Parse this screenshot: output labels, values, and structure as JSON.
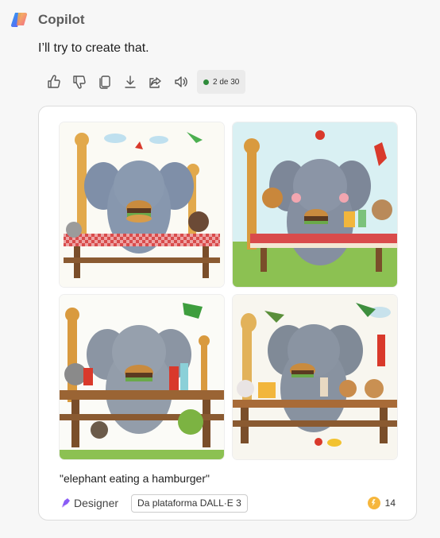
{
  "app": {
    "name": "Copilot"
  },
  "message": {
    "text": "I’ll try to create that."
  },
  "toolbar": {
    "actions": [
      {
        "icon": "thumbs-up-icon",
        "label": "Like"
      },
      {
        "icon": "thumbs-down-icon",
        "label": "Dislike"
      },
      {
        "icon": "copy-icon",
        "label": "Copy"
      },
      {
        "icon": "download-icon",
        "label": "Download"
      },
      {
        "icon": "share-icon",
        "label": "Share"
      },
      {
        "icon": "speaker-icon",
        "label": "Read aloud"
      }
    ],
    "counter": "2 de 30",
    "counter_color": "#2e8b3a"
  },
  "result": {
    "prompt": "\"elephant eating a hamburger\"",
    "images": [
      {
        "alt": "elephant eating a hamburger"
      },
      {
        "alt": "elephant eating a hamburger"
      },
      {
        "alt": "elephant eating a hamburger"
      },
      {
        "alt": "elephant eating a hamburger"
      }
    ],
    "source_label": "Designer",
    "platform_badge": "Da plataforma DALL·E 3",
    "boosts": "14",
    "accent": "#8a5cf6",
    "boost_color": "#f6b63c"
  }
}
